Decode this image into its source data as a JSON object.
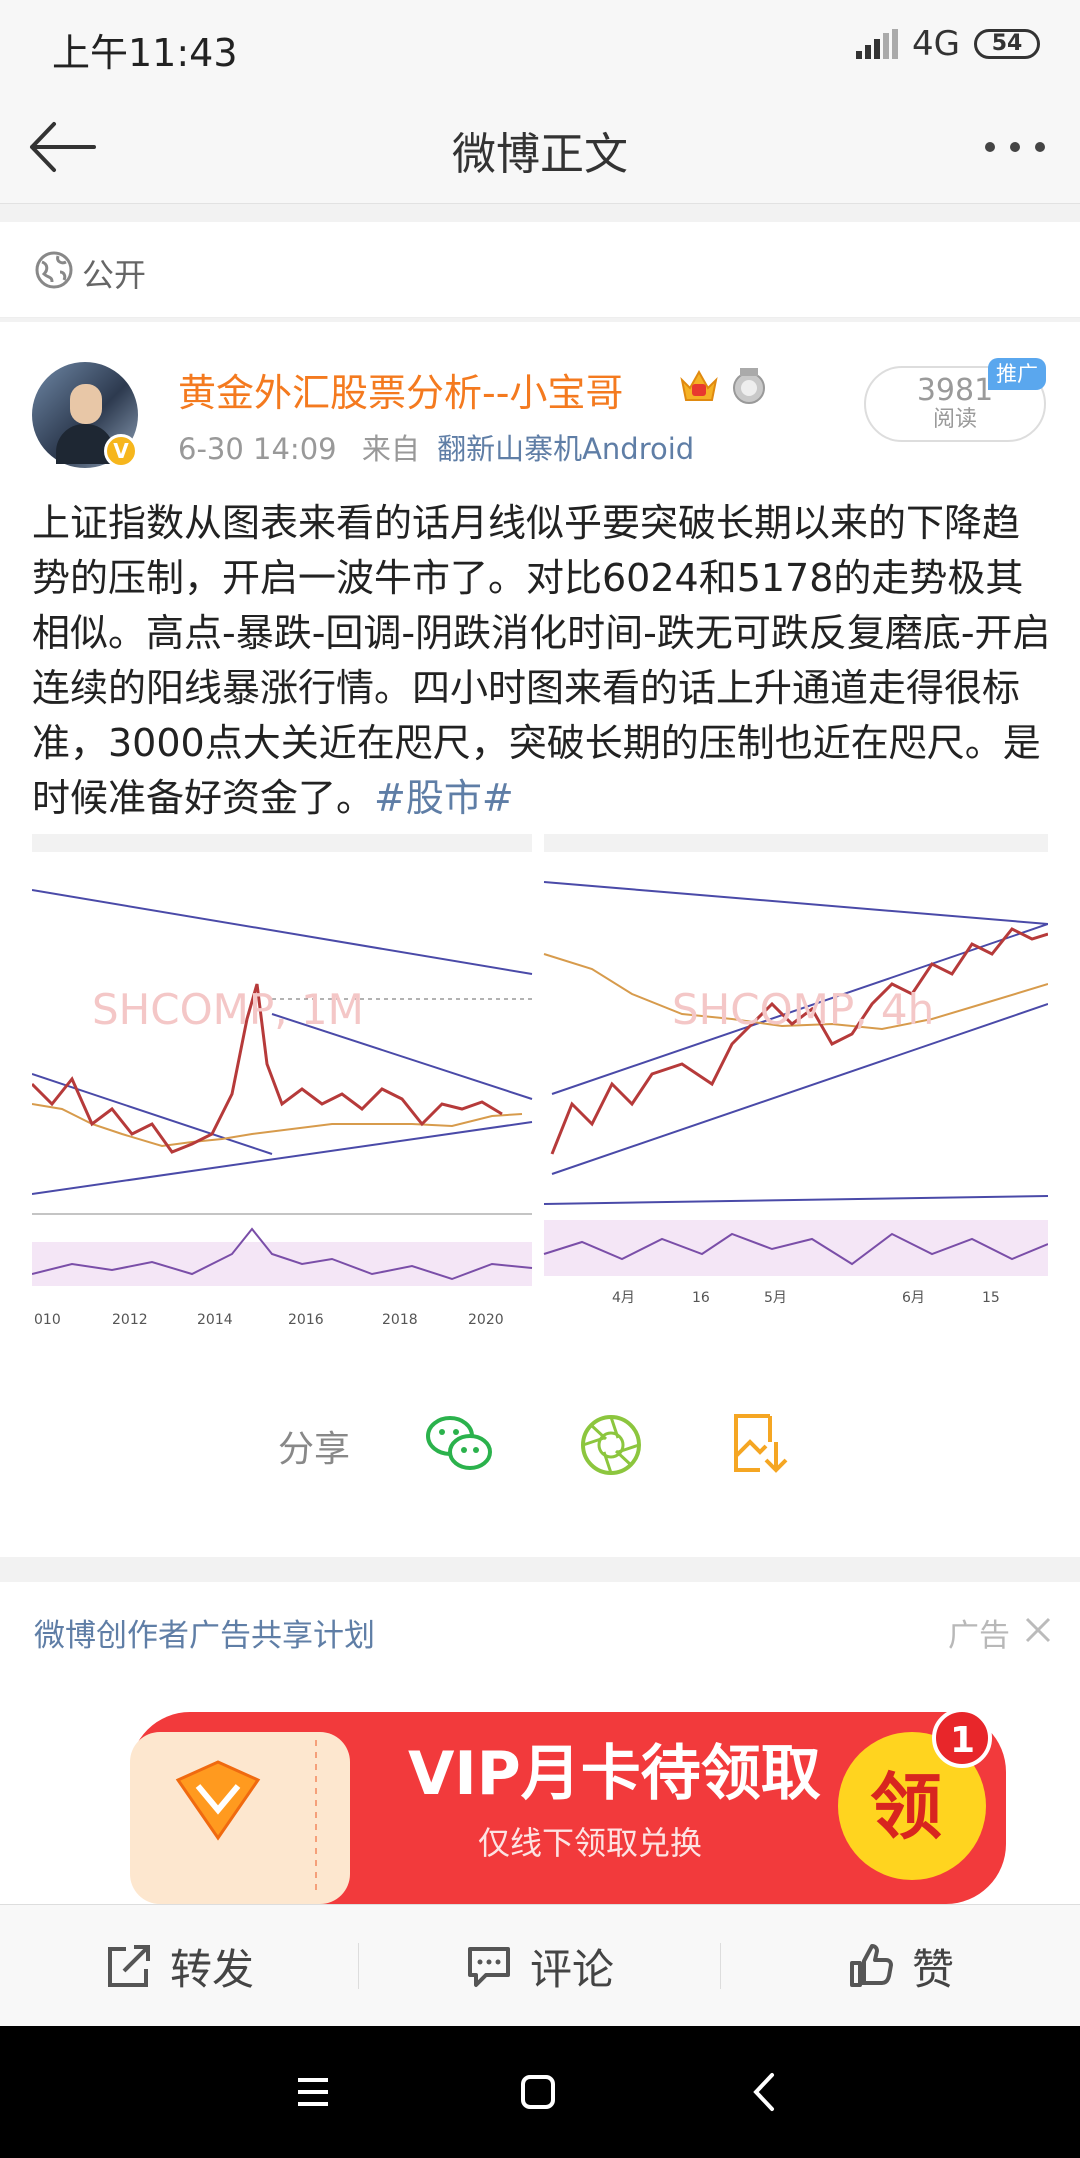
{
  "status": {
    "time": "上午11:43",
    "network": "4G",
    "battery": "54"
  },
  "header": {
    "title": "微博正文"
  },
  "visibility": {
    "label": "公开"
  },
  "post": {
    "username": "黄金外汇股票分析--小宝哥",
    "date": "6-30 14:09",
    "source_prefix": "来自",
    "source": "翻新山寨机Android",
    "read_count": "3981",
    "read_label": "阅读",
    "promo_badge": "推广",
    "text": "上证指数从图表来看的话月线似乎要突破长期以来的下降趋势的压制，开启一波牛市了。对比6024和5178的走势极其相似。高点-暴跌-回调-阴跌消化时间-跌无可跌反复磨底-开启连续的阳线暴涨行情。四小时图来看的话上升通道走得很标准，3000点大关近在咫尺，突破长期的压制也近在咫尺。是时候准备好资金了。",
    "hashtag": "#股市#",
    "chart_left": {
      "title": "SHCOMP, 1M",
      "x_labels": [
        "010",
        "2012",
        "2014",
        "2016",
        "2018",
        "2020"
      ]
    },
    "chart_right": {
      "title": "SHCOMP, 4h",
      "x_labels": [
        "4月",
        "16",
        "5月",
        "6月",
        "15"
      ]
    }
  },
  "share": {
    "label": "分享",
    "icons": [
      "wechat-icon",
      "moments-icon",
      "save-image-icon"
    ]
  },
  "ad": {
    "title": "微博创作者广告共享计划",
    "label": "广告",
    "banner_main": "VIP月卡待领取",
    "banner_sub": "仅线下领取兑换",
    "banner_button": "领",
    "banner_count": "1",
    "colors": {
      "banner_red": "#f23a3c",
      "button_yellow": "#ffd41f"
    }
  },
  "actions": {
    "repost": "转发",
    "comment": "评论",
    "like": "赞"
  },
  "colors": {
    "username": "#f47a1f",
    "link": "#5f7ea6"
  }
}
